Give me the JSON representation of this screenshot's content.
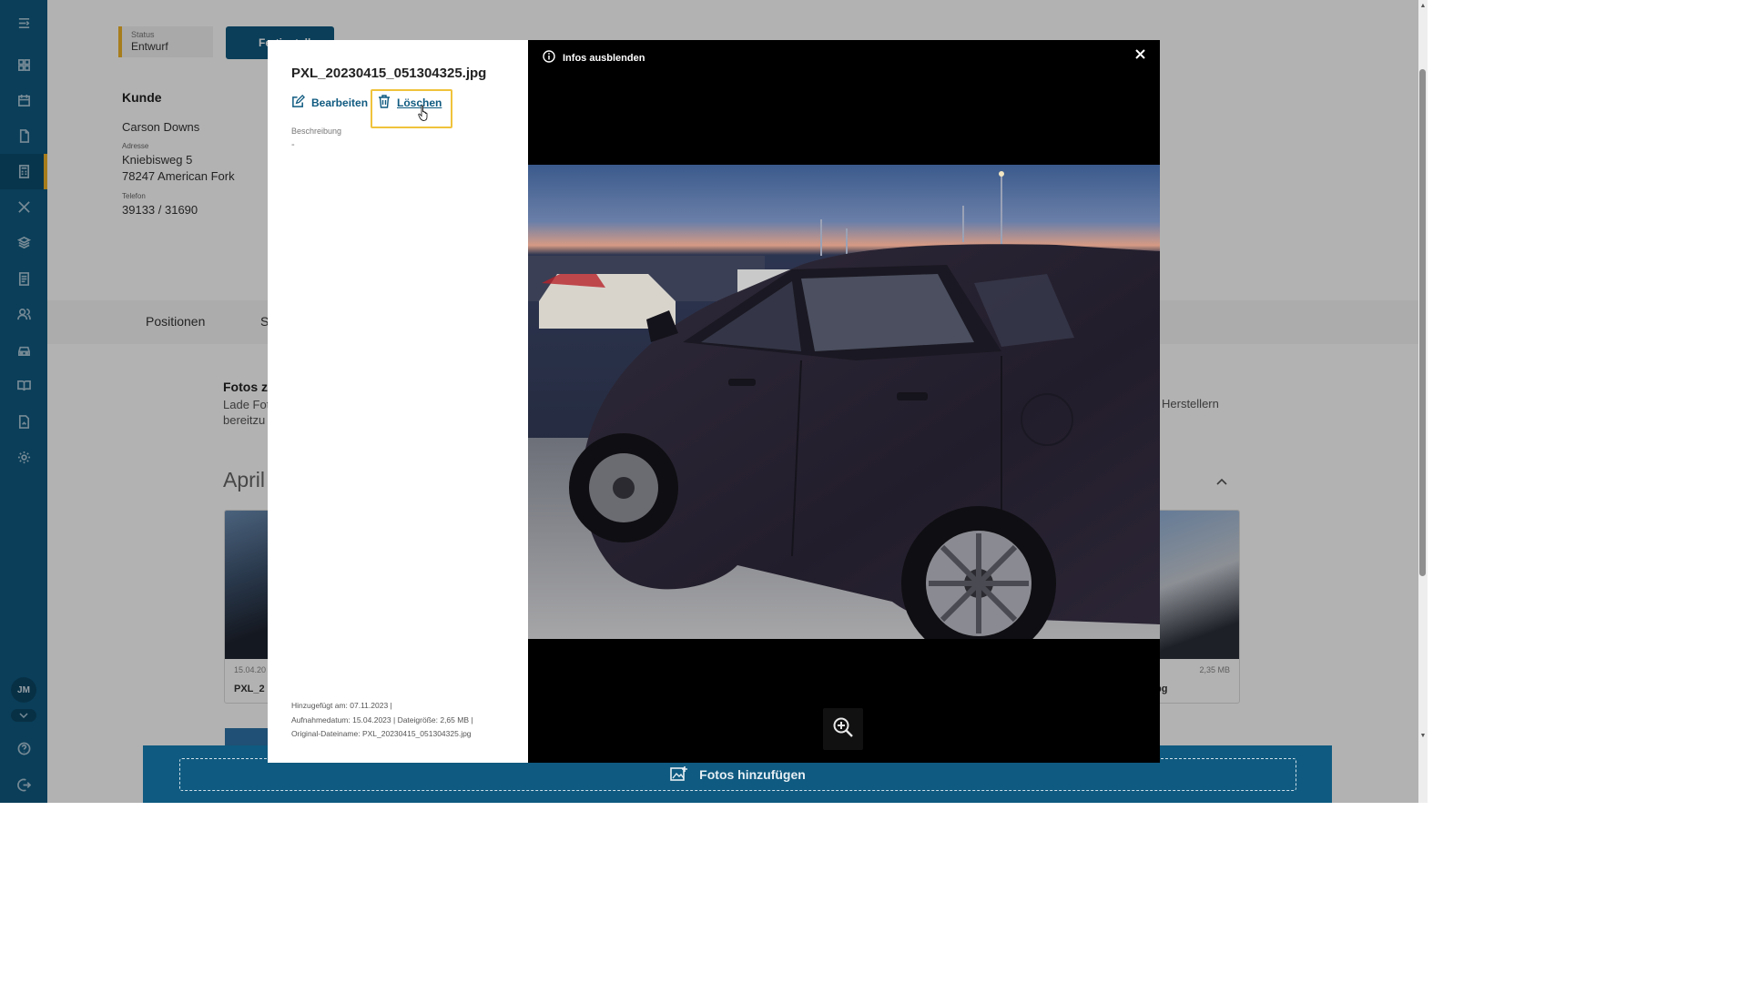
{
  "status": {
    "label": "Status",
    "value": "Entwurf"
  },
  "primary_button": {
    "label": "Fertigstellen"
  },
  "customer": {
    "section_title": "Kunde",
    "name": "Carson Downs",
    "address_label": "Adresse",
    "street": "Kniebisweg 5",
    "city": "78247 American Fork",
    "phone_label": "Telefon",
    "phone": "39133 / 31690"
  },
  "tabs": {
    "positions": "Positionen",
    "second_partial": "S"
  },
  "photos_section": {
    "title_partial": "Fotos z",
    "desc_line1_partial": "Lade Fot",
    "desc_line2_partial": "bereitzu",
    "desc_right_partial": "Herstellern",
    "month_partial": "April"
  },
  "thumbnails": [
    {
      "date_partial": "15.04.20",
      "name_partial": "PXL_2"
    },
    {
      "size": "2,35 MB",
      "name_partial": "pg"
    }
  ],
  "sidebar": {
    "avatar_initials": "JM",
    "icons": [
      "menu-collapse-icon",
      "dashboard-icon",
      "calendar-icon",
      "document-icon",
      "calculator-icon",
      "tools-icon",
      "layers-icon",
      "invoice-icon",
      "customers-icon",
      "car-icon",
      "book-icon",
      "report-icon",
      "settings-icon",
      "help-icon",
      "logout-icon"
    ]
  },
  "add_photos": {
    "label": "Fotos hinzufügen"
  },
  "modal": {
    "file_name": "PXL_20230415_051304325.jpg",
    "edit_label": "Bearbeiten",
    "delete_label": "Löschen",
    "description_label": "Beschreibung",
    "description_value": "-",
    "added_line": "Hinzugefügt am: 07.11.2023 |",
    "taken_line": "Aufnahmedatum: 15.04.2023 | Dateigröße: 2,65 MB |",
    "original_line": "Original-Dateiname: PXL_20230415_051304325.jpg",
    "hide_info_label": "Infos ausblenden"
  },
  "colors": {
    "sidebar": "#0f5a80",
    "accent": "#f0b429",
    "highlight": "#f0c33c",
    "link": "#0f5a80",
    "viewer_bg": "#000000"
  }
}
